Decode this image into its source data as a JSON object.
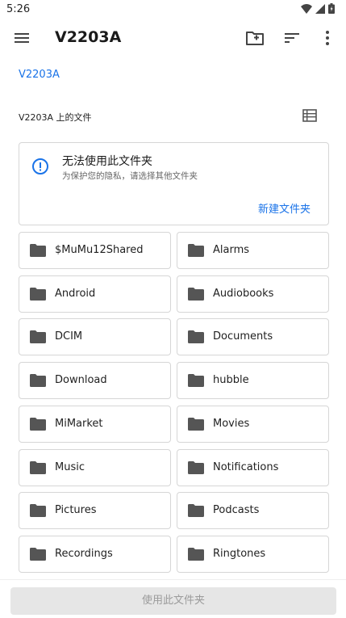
{
  "status_bar": {
    "time": "5:26"
  },
  "app_bar": {
    "title": "V2203A"
  },
  "breadcrumb": {
    "root": "V2203A"
  },
  "section": {
    "label": "V2203A 上的文件"
  },
  "notice": {
    "title": "无法使用此文件夹",
    "subtitle": "为保护您的隐私，请选择其他文件夹",
    "action_label": "新建文件夹"
  },
  "folders": [
    "$MuMu12Shared",
    "Alarms",
    "Android",
    "Audiobooks",
    "DCIM",
    "Documents",
    "Download",
    "hubble",
    "MiMarket",
    "Movies",
    "Music",
    "Notifications",
    "Pictures",
    "Podcasts",
    "Recordings",
    "Ringtones"
  ],
  "bottom": {
    "use_button_label": "使用此文件夹"
  },
  "colors": {
    "accent": "#1a73e8",
    "icon": "#555555",
    "disabled_bg": "#e6e6e6"
  }
}
